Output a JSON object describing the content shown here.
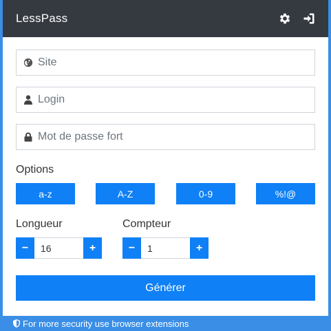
{
  "header": {
    "title": "LessPass",
    "settings_icon": "gear-icon",
    "login_icon": "sign-in-icon"
  },
  "form": {
    "site": {
      "placeholder": "Site",
      "value": "",
      "icon": "globe-icon"
    },
    "login": {
      "placeholder": "Login",
      "value": "",
      "icon": "user-icon"
    },
    "master_password": {
      "placeholder": "Mot de passe fort",
      "value": "",
      "icon": "lock-icon"
    }
  },
  "options": {
    "label": "Options",
    "buttons": [
      {
        "label": "a-z"
      },
      {
        "label": "A-Z"
      },
      {
        "label": "0-9"
      },
      {
        "label": "%!@"
      }
    ]
  },
  "length": {
    "label": "Longueur",
    "value": "16",
    "minus": "−",
    "plus": "+"
  },
  "counter": {
    "label": "Compteur",
    "value": "1",
    "minus": "−",
    "plus": "+"
  },
  "generate": {
    "label": "Générer"
  },
  "footer": {
    "text": "For more security use browser extensions",
    "icon": "shield-icon"
  },
  "colors": {
    "accent": "#0f80f5",
    "header_bg": "#343a40",
    "footer_bg": "#3a8ee6"
  }
}
